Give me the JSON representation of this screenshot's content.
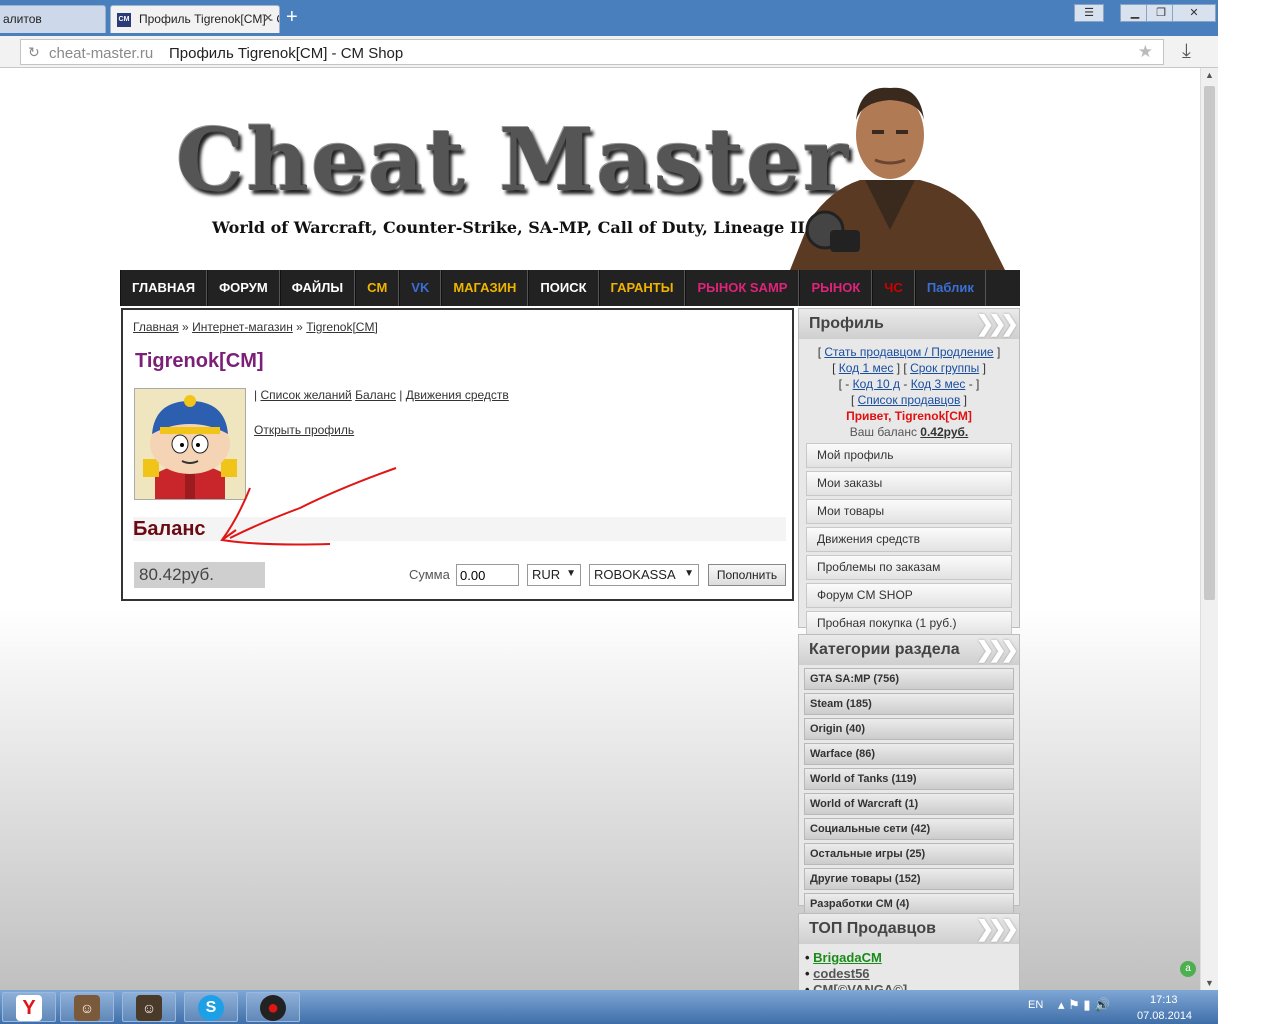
{
  "browser": {
    "tabs": [
      {
        "label": "алитов"
      },
      {
        "label": "Профиль Tigrenok[CM] - CM Shop"
      }
    ],
    "url_domain": "cheat-master.ru",
    "url_title": "Профиль Tigrenok[CM] - CM Shop"
  },
  "header": {
    "logo": "Cheat Master",
    "tagline": "World of Warcraft, Counter-Strike, SA-MP, Call of Duty, Lineage II"
  },
  "nav": [
    {
      "label": "ГЛАВНАЯ",
      "color": "#ffffff"
    },
    {
      "label": "ФОРУМ",
      "color": "#ffffff"
    },
    {
      "label": "ФАЙЛЫ",
      "color": "#ffffff"
    },
    {
      "label": "CM",
      "color": "#f0b400"
    },
    {
      "label": "VK",
      "color": "#3b6fd6"
    },
    {
      "label": "МАГАЗИН",
      "color": "#f0b400"
    },
    {
      "label": "ПОИСК",
      "color": "#ffffff"
    },
    {
      "label": "ГАРАНТЫ",
      "color": "#f0b400"
    },
    {
      "label": "РЫНОК SAMP",
      "color": "#e0237a"
    },
    {
      "label": "РЫНОК",
      "color": "#e0237a"
    },
    {
      "label": "ЧС",
      "color": "#d00000"
    },
    {
      "label": "Паблик",
      "color": "#3b6fd6"
    }
  ],
  "breadcrumb": {
    "home": "Главная",
    "sep": "»",
    "shop": "Интернет-магазин",
    "profile": "Tigrenok[CM]"
  },
  "profile": {
    "username": "Tigrenok[CM]",
    "link_sep": "|",
    "wishlist": "Список желаний",
    "balance_link": "Баланс",
    "transactions": "Движения средств",
    "open_profile": "Открыть профиль"
  },
  "balance": {
    "heading": "Баланс",
    "amount": "80.42руб.",
    "sum_label": "Сумма",
    "sum_value": "0.00",
    "currency": "RUR",
    "gateway": "ROBOKASSA",
    "topup": "Пополнить"
  },
  "sidebar": {
    "profile_title": "Профиль",
    "become_seller": "Стать продавцом / Продление",
    "code_1m": "Код 1 мес",
    "group_term": "Срок группы",
    "code_10d": "Код 10 д",
    "code_3m": "Код 3 мес",
    "seller_list": "Список продавцов",
    "greeting": "Привет, Tigrenok[CM]",
    "balance_label": "Ваш баланс",
    "balance_value": "0.42руб.",
    "menu": [
      "Мой профиль",
      "Мои заказы",
      "Мои товары",
      "Движения средств",
      "Проблемы по заказам",
      "Форум CM SHOP",
      "Пробная покупка (1 руб.)"
    ],
    "categories_title": "Категории раздела",
    "categories": [
      "GTA SA:MP (756)",
      "Steam (185)",
      "Origin (40)",
      "Warface (86)",
      "World of Tanks (119)",
      "World of Warcraft (1)",
      "Социальные сети (42)",
      "Остальные игры (25)",
      "Другие товары (152)",
      "Разработки CM (4)"
    ],
    "top_title": "ТОП Продавцов",
    "sellers": [
      {
        "name": "BrigadaCM",
        "color": "#1a8a1a"
      },
      {
        "name": "codest56",
        "color": "#555555"
      },
      {
        "name": "CM[©VANGA©]",
        "color": "#555555"
      }
    ]
  },
  "taskbar": {
    "lang": "EN",
    "time": "17:13",
    "date": "07.08.2014"
  }
}
